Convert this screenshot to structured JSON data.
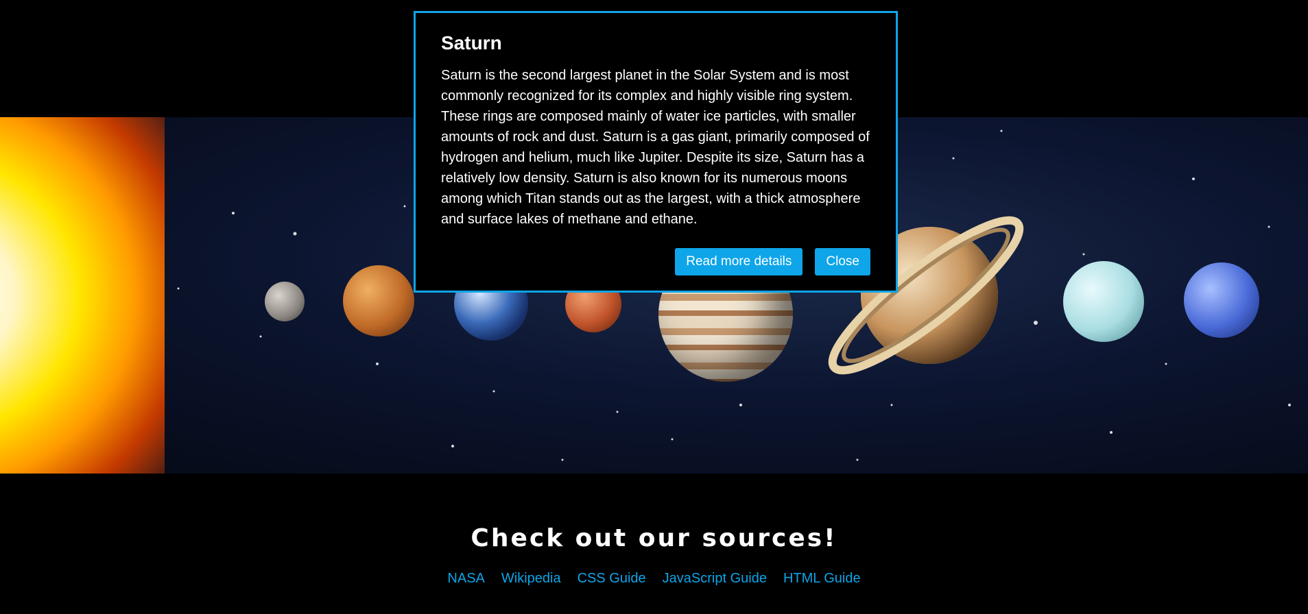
{
  "dialog": {
    "title": "Saturn",
    "body": "Saturn is the second largest planet in the Solar System and is most commonly recognized for its complex and highly visible ring system. These rings are composed mainly of water ice particles, with smaller amounts of rock and dust. Saturn is a gas giant, primarily composed of hydrogen and helium, much like Jupiter. Despite its size, Saturn has a relatively low density. Saturn is also known for its numerous moons among which Titan stands out as the largest, with a thick atmosphere and surface lakes of methane and ethane.",
    "read_more_label": "Read more details",
    "close_label": "Close"
  },
  "sources": {
    "heading": "Check out our sources!",
    "links": [
      "NASA",
      "Wikipedia",
      "CSS Guide",
      "JavaScript Guide",
      "HTML Guide"
    ]
  },
  "colors": {
    "accent": "#0ea5e9",
    "background": "#000000"
  }
}
